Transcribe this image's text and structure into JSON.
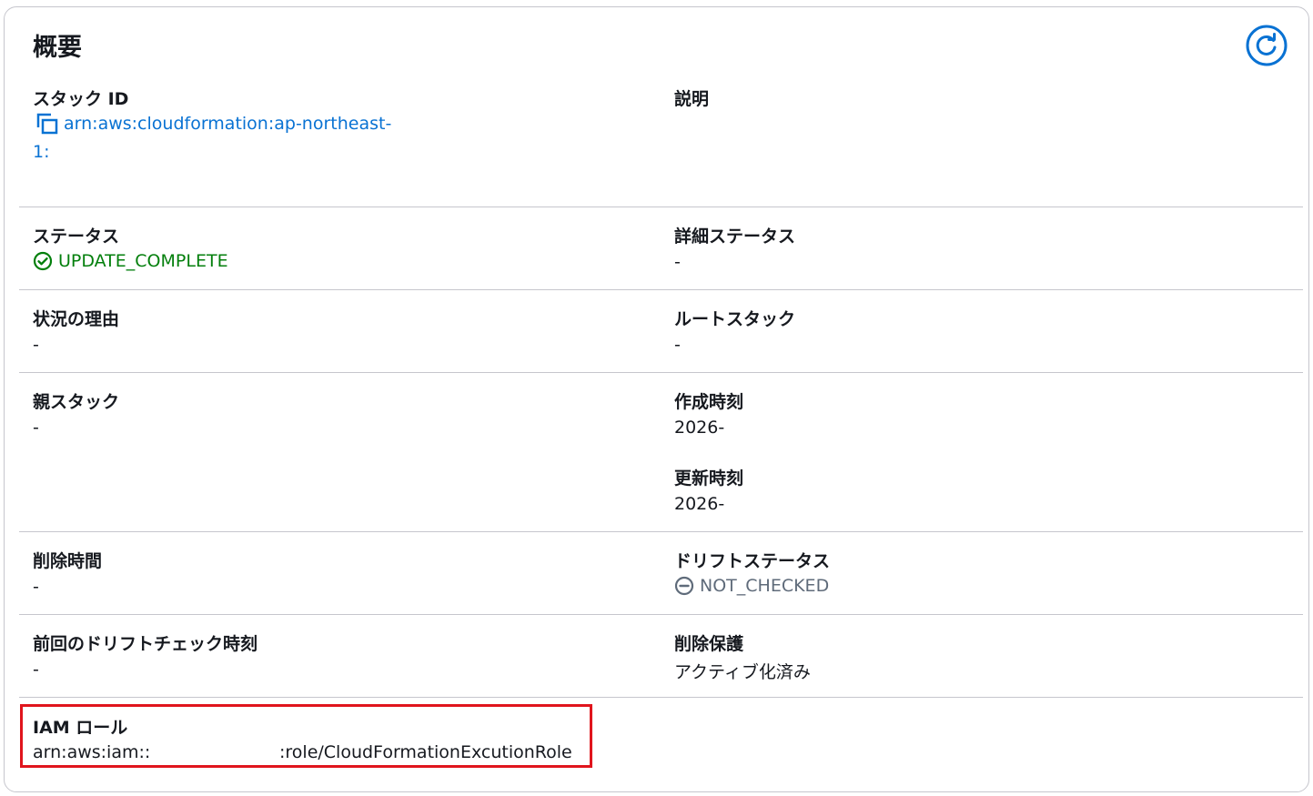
{
  "panel": {
    "title": "概要",
    "refresh_icon": "refresh-icon"
  },
  "fields": {
    "stack_id_label": "スタック ID",
    "stack_id_value_line1": "arn:aws:cloudformation:ap-northeast-",
    "stack_id_value_line2": "1:",
    "description_label": "説明",
    "status_label": "ステータス",
    "status_value": "UPDATE_COMPLETE",
    "detailed_status_label": "詳細ステータス",
    "detailed_status_value": "-",
    "status_reason_label": "状況の理由",
    "status_reason_value": "-",
    "root_stack_label": "ルートスタック",
    "root_stack_value": "-",
    "parent_stack_label": "親スタック",
    "parent_stack_value": "-",
    "created_label": "作成時刻",
    "created_value": "2026-",
    "updated_label": "更新時刻",
    "updated_value": "2026-",
    "deletion_time_label": "削除時間",
    "deletion_time_value": "-",
    "drift_status_label": "ドリフトステータス",
    "drift_status_value": "NOT_CHECKED",
    "last_drift_check_label": "前回のドリフトチェック時刻",
    "last_drift_check_value": "-",
    "termination_protection_label": "削除保護",
    "termination_protection_value": "アクティブ化済み",
    "iam_role_label": "IAM ロール",
    "iam_role_value_prefix": "arn:aws:iam::",
    "iam_role_value_suffix": ":role/CloudFormationExcutionRole"
  },
  "colors": {
    "link": "#0972d3",
    "success": "#037f0c",
    "muted": "#5f6b7a",
    "highlight": "#e0151d"
  }
}
